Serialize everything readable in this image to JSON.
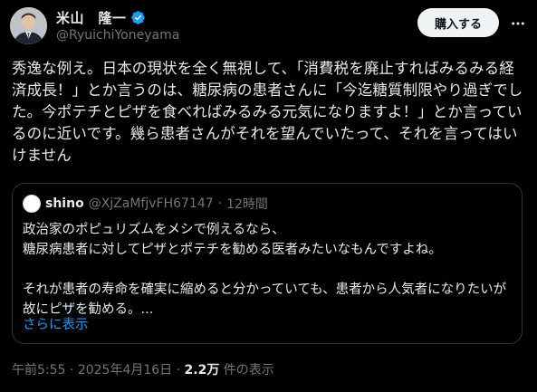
{
  "author": {
    "display_name": "米山　隆一",
    "handle": "@RyuichiYoneyama"
  },
  "actions": {
    "subscribe_label": "購入する"
  },
  "tweet": {
    "text": "秀逸な例え。日本の現状を全く無視して、「消費税を廃止すればみるみる経済成長！」とか言うのは、糖尿病の患者さんに「今迄糖質制限やり過ぎでした。今ポテチとピザを食べればみるみる元気になりますよ！」とか言っているのに近いです。幾ら患者さんがそれを望んでいたって、それを言ってはいけません"
  },
  "quote": {
    "name": "shino",
    "handle": "@XjZaMfjvFH67147",
    "separator": "·",
    "time": "12時間",
    "body": "政治家のポピュリズムをメシで例えるなら、\n糖尿病患者に対してピザとポテチを勧める医者みたいなもんですよね。\n\nそれが患者の寿命を確実に縮めると分かっていても、患者から人気者になりたいが故にピザを勧める。...",
    "show_more": "さらに表示"
  },
  "meta": {
    "time": "午前5:55",
    "dot1": " · ",
    "date": "2025年4月16日",
    "dot2": " · ",
    "views_count": "2.2万",
    "views_label": " 件の表示"
  },
  "icons": {
    "verified": "verified-badge-icon",
    "more": "more-dots-icon"
  },
  "colors": {
    "background": "#000000",
    "text": "#e7e9ea",
    "muted": "#71767b",
    "link": "#1d9bf0",
    "border": "#2f3336",
    "button_bg": "#eff3f4"
  }
}
